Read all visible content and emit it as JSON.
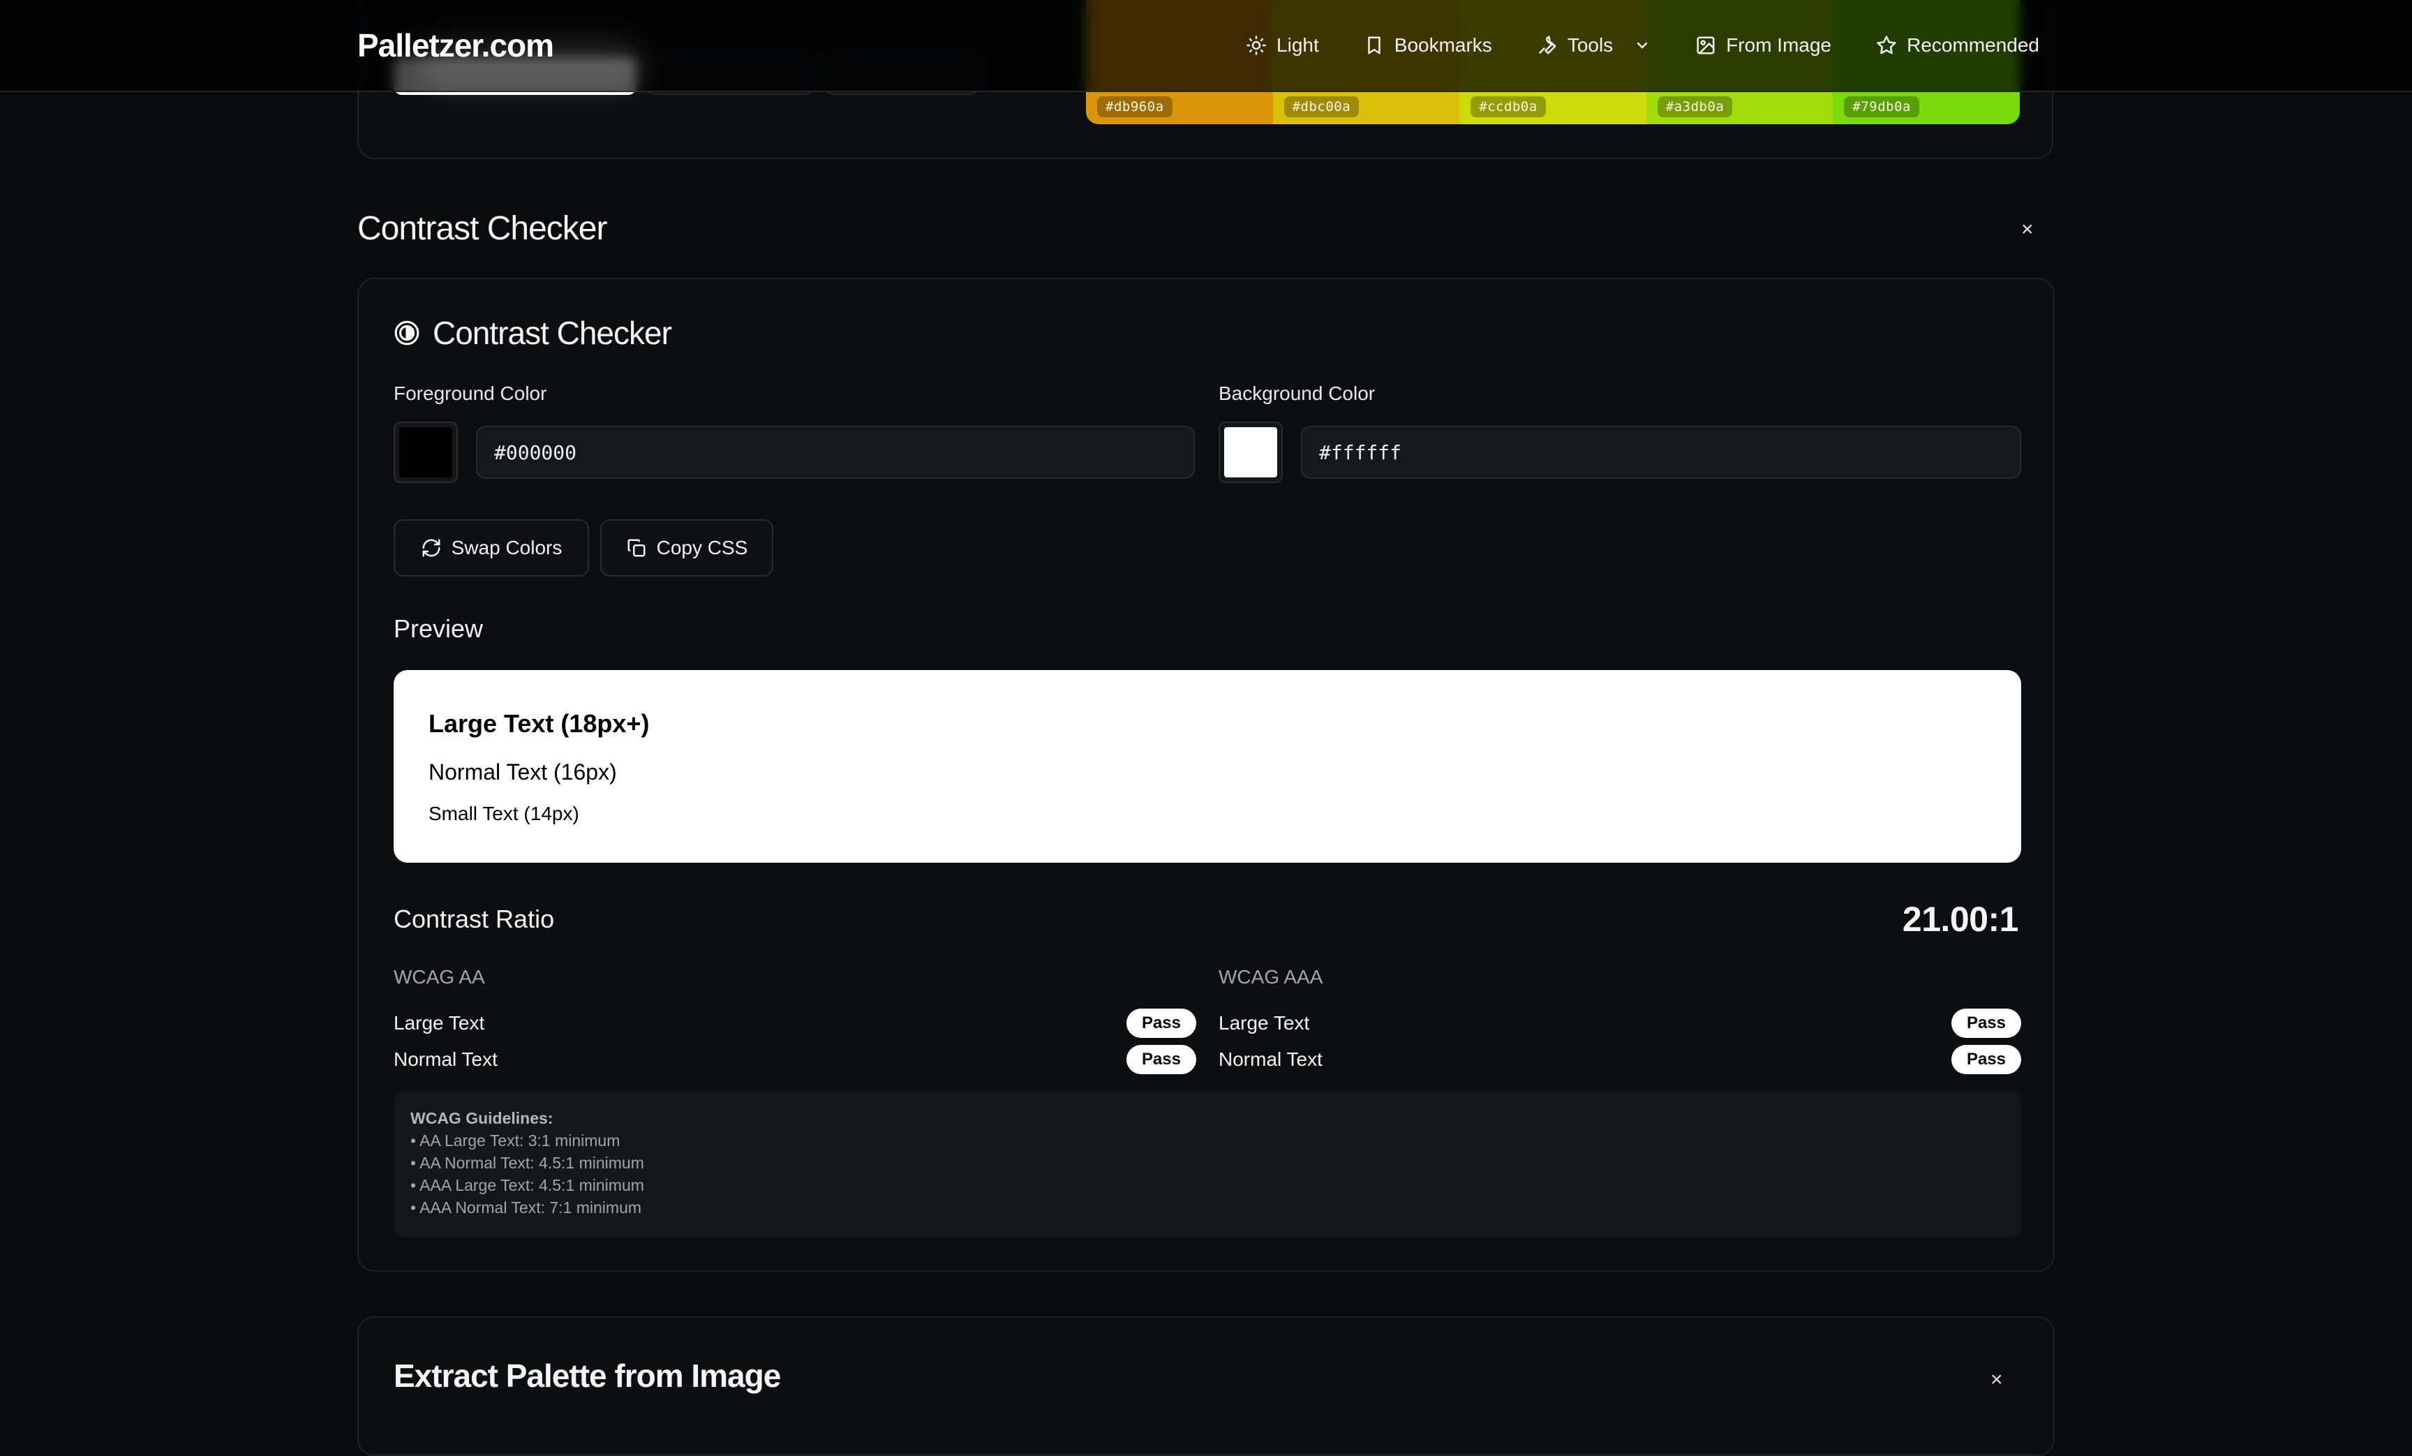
{
  "header": {
    "brand": "Palletzer.com",
    "nav": [
      {
        "label": "Light",
        "icon": "sun-icon"
      },
      {
        "label": "Bookmarks",
        "icon": "bookmark-icon"
      },
      {
        "label": "Tools",
        "icon": "wrench-icon"
      },
      {
        "label": "From Image",
        "icon": "image-icon"
      },
      {
        "label": "Recommended",
        "icon": "star-icon"
      }
    ]
  },
  "palette_strip": {
    "swatches": [
      {
        "hex": "#db960a",
        "color": "#db960a"
      },
      {
        "hex": "#dbc00a",
        "color": "#dbc00a"
      },
      {
        "hex": "#ccdb0a",
        "color": "#ccdb0a"
      },
      {
        "hex": "#a3db0a",
        "color": "#a3db0a"
      },
      {
        "hex": "#79db0a",
        "color": "#79db0a"
      }
    ]
  },
  "section": {
    "title": "Contrast Checker",
    "close": "×"
  },
  "checker": {
    "title": "Contrast Checker",
    "foreground": {
      "label": "Foreground Color",
      "value": "#000000",
      "color": "#000000"
    },
    "background": {
      "label": "Background Color",
      "value": "#ffffff",
      "color": "#ffffff"
    },
    "swap_label": "Swap Colors",
    "copy_label": "Copy CSS",
    "preview": {
      "heading": "Preview",
      "large": "Large Text (18px+)",
      "normal": "Normal Text (16px)",
      "small": "Small Text (14px)"
    },
    "ratio": {
      "label": "Contrast Ratio",
      "value": "21.00:1"
    },
    "aa": {
      "title": "WCAG AA",
      "rows": [
        {
          "label": "Large Text",
          "status": "Pass"
        },
        {
          "label": "Normal Text",
          "status": "Pass"
        }
      ]
    },
    "aaa": {
      "title": "WCAG AAA",
      "rows": [
        {
          "label": "Large Text",
          "status": "Pass"
        },
        {
          "label": "Normal Text",
          "status": "Pass"
        }
      ]
    },
    "guidelines": {
      "title": "WCAG Guidelines:",
      "items": [
        "• AA Large Text: 3:1 minimum",
        "• AA Normal Text: 4.5:1 minimum",
        "• AAA Large Text: 4.5:1 minimum",
        "• AAA Normal Text: 7:1 minimum"
      ]
    }
  },
  "next_section": {
    "title": "Extract Palette from Image",
    "close": "×"
  }
}
